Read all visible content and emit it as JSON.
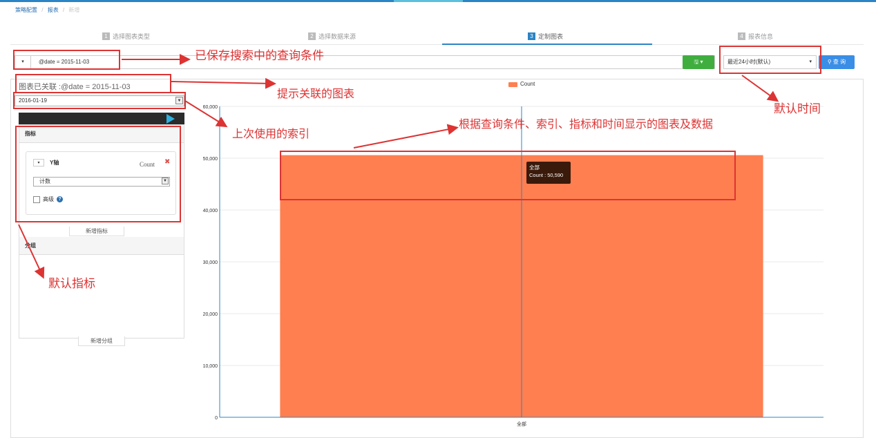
{
  "breadcrumb": {
    "item1": "策略配置",
    "item2": "报表",
    "item3": "新增"
  },
  "steps": [
    {
      "num": "1",
      "label": "选择图表类型"
    },
    {
      "num": "2",
      "label": "选择数据来源"
    },
    {
      "num": "3",
      "label": "定制图表"
    },
    {
      "num": "4",
      "label": "报表信息"
    }
  ],
  "query": {
    "text": "@date = 2015-11-03",
    "caret": "▾"
  },
  "save_button": {
    "label": "🖫 ▾"
  },
  "time_range": {
    "selected": "最近24小时(默认)",
    "caret": "▾"
  },
  "query_button": {
    "label": "查 询"
  },
  "linked_tip": "图表已关联 :@date = 2015-11-03",
  "index_select": {
    "value": "2016-01-19"
  },
  "metrics": {
    "header": "指标",
    "axis_label": "Y轴",
    "field": "Count",
    "aggregation": "计数",
    "advanced": "高级",
    "add_button": "新增指标"
  },
  "groups": {
    "header": "分组",
    "add_button": "新增分组"
  },
  "chart_data": {
    "type": "bar",
    "categories": [
      "全部"
    ],
    "series": [
      {
        "name": "Count",
        "values": [
          50590
        ]
      }
    ],
    "y_ticks": [
      "0",
      "10,000",
      "20,000",
      "30,000",
      "40,000",
      "50,000",
      "60,000"
    ],
    "ylim": [
      0,
      60000
    ],
    "legend": "top-center",
    "grid": true,
    "bar_color": "#ff7f50",
    "axis_color": "#2a84c6"
  },
  "tooltip": {
    "title": "全部",
    "text": "Count : 50,590"
  },
  "annotations": {
    "saved_query": "已保存搜索中的查询条件",
    "linked_chart": "提示关联的图表",
    "default_time": "默认时间",
    "last_index": "上次使用的索引",
    "chart_desc": "根据查询条件、索引、指标和时间显示的图表及数据",
    "default_metric": "默认指标"
  },
  "colors": {
    "accent": "#2a84c6",
    "annotation": "#dd3333",
    "save": "#3fae3f",
    "query": "#3a8ee6"
  }
}
